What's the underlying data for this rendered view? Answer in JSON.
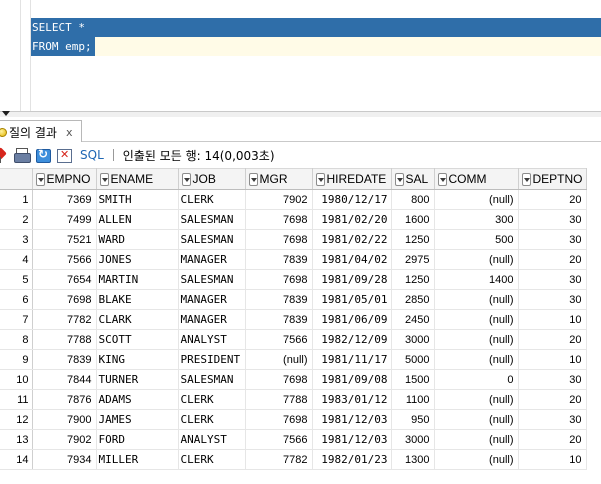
{
  "editor": {
    "lines": [
      "SELECT * ",
      "FROM emp;"
    ]
  },
  "results_tab": {
    "label": "질의 결과",
    "close": "x"
  },
  "toolbar": {
    "sql_label": "SQL",
    "status": "인출된 모든 행: 14(0,003초)"
  },
  "grid": {
    "columns": [
      "EMPNO",
      "ENAME",
      "JOB",
      "MGR",
      "HIREDATE",
      "SAL",
      "COMM",
      "DEPTNO"
    ],
    "rows": [
      [
        "1",
        "7369",
        "SMITH",
        "CLERK",
        "7902",
        "1980/12/17",
        "800",
        "(null)",
        "20"
      ],
      [
        "2",
        "7499",
        "ALLEN",
        "SALESMAN",
        "7698",
        "1981/02/20",
        "1600",
        "300",
        "30"
      ],
      [
        "3",
        "7521",
        "WARD",
        "SALESMAN",
        "7698",
        "1981/02/22",
        "1250",
        "500",
        "30"
      ],
      [
        "4",
        "7566",
        "JONES",
        "MANAGER",
        "7839",
        "1981/04/02",
        "2975",
        "(null)",
        "20"
      ],
      [
        "5",
        "7654",
        "MARTIN",
        "SALESMAN",
        "7698",
        "1981/09/28",
        "1250",
        "1400",
        "30"
      ],
      [
        "6",
        "7698",
        "BLAKE",
        "MANAGER",
        "7839",
        "1981/05/01",
        "2850",
        "(null)",
        "30"
      ],
      [
        "7",
        "7782",
        "CLARK",
        "MANAGER",
        "7839",
        "1981/06/09",
        "2450",
        "(null)",
        "10"
      ],
      [
        "8",
        "7788",
        "SCOTT",
        "ANALYST",
        "7566",
        "1982/12/09",
        "3000",
        "(null)",
        "20"
      ],
      [
        "9",
        "7839",
        "KING",
        "PRESIDENT",
        "(null)",
        "1981/11/17",
        "5000",
        "(null)",
        "10"
      ],
      [
        "10",
        "7844",
        "TURNER",
        "SALESMAN",
        "7698",
        "1981/09/08",
        "1500",
        "0",
        "30"
      ],
      [
        "11",
        "7876",
        "ADAMS",
        "CLERK",
        "7788",
        "1983/01/12",
        "1100",
        "(null)",
        "20"
      ],
      [
        "12",
        "7900",
        "JAMES",
        "CLERK",
        "7698",
        "1981/12/03",
        "950",
        "(null)",
        "30"
      ],
      [
        "13",
        "7902",
        "FORD",
        "ANALYST",
        "7566",
        "1981/12/03",
        "3000",
        "(null)",
        "20"
      ],
      [
        "14",
        "7934",
        "MILLER",
        "CLERK",
        "7782",
        "1982/01/23",
        "1300",
        "(null)",
        "10"
      ]
    ]
  }
}
